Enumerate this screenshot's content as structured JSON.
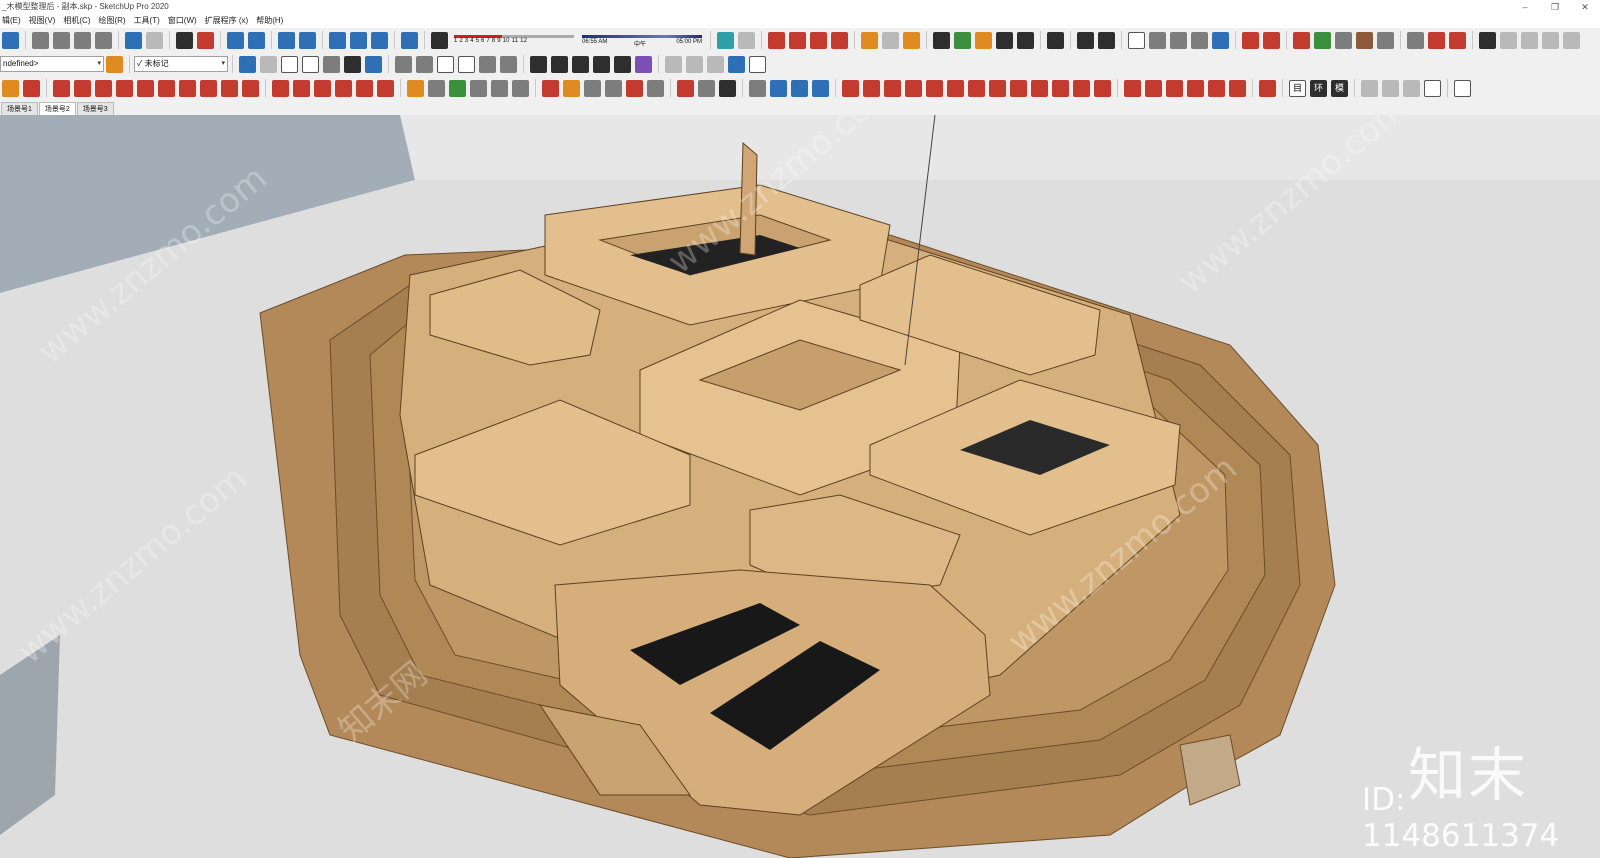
{
  "window": {
    "title": "_木模型整理后 - 副本.skp - SketchUp Pro 2020",
    "minimize": "–",
    "restore": "❐",
    "close": "✕"
  },
  "menu": {
    "items": [
      "辑(E)",
      "视图(V)",
      "相机(C)",
      "绘图(R)",
      "工具(T)",
      "窗口(W)",
      "扩展程序 (x)",
      "帮助(H)"
    ]
  },
  "shadow_slider": {
    "months": "1 2 3 4 5 6 7 8 9 10 11 12",
    "time_start": "06:55 AM",
    "time_mid": "中午",
    "time_end": "05:00 PM"
  },
  "layer_select": {
    "value": "ndefined>"
  },
  "tag_select": {
    "value": "✓ 未标记"
  },
  "toolbar_text": {
    "t1": "目",
    "t2": "环",
    "t3": "模"
  },
  "scenes": {
    "tabs": [
      "场景号1",
      "场景号2",
      "场景号3"
    ],
    "active_index": 1
  },
  "watermark": {
    "brand": "知末",
    "id": "ID: 1148611374",
    "site": "www.znzmo.com",
    "site_cn": "知末网"
  },
  "colors": {
    "sky": "#e6e6e6",
    "ground_gray": "#dcdcdc",
    "terrain": "#b08a5b",
    "building": "#dcb682",
    "building_dark": "#b98f5d",
    "void": "#1a1a1a"
  }
}
